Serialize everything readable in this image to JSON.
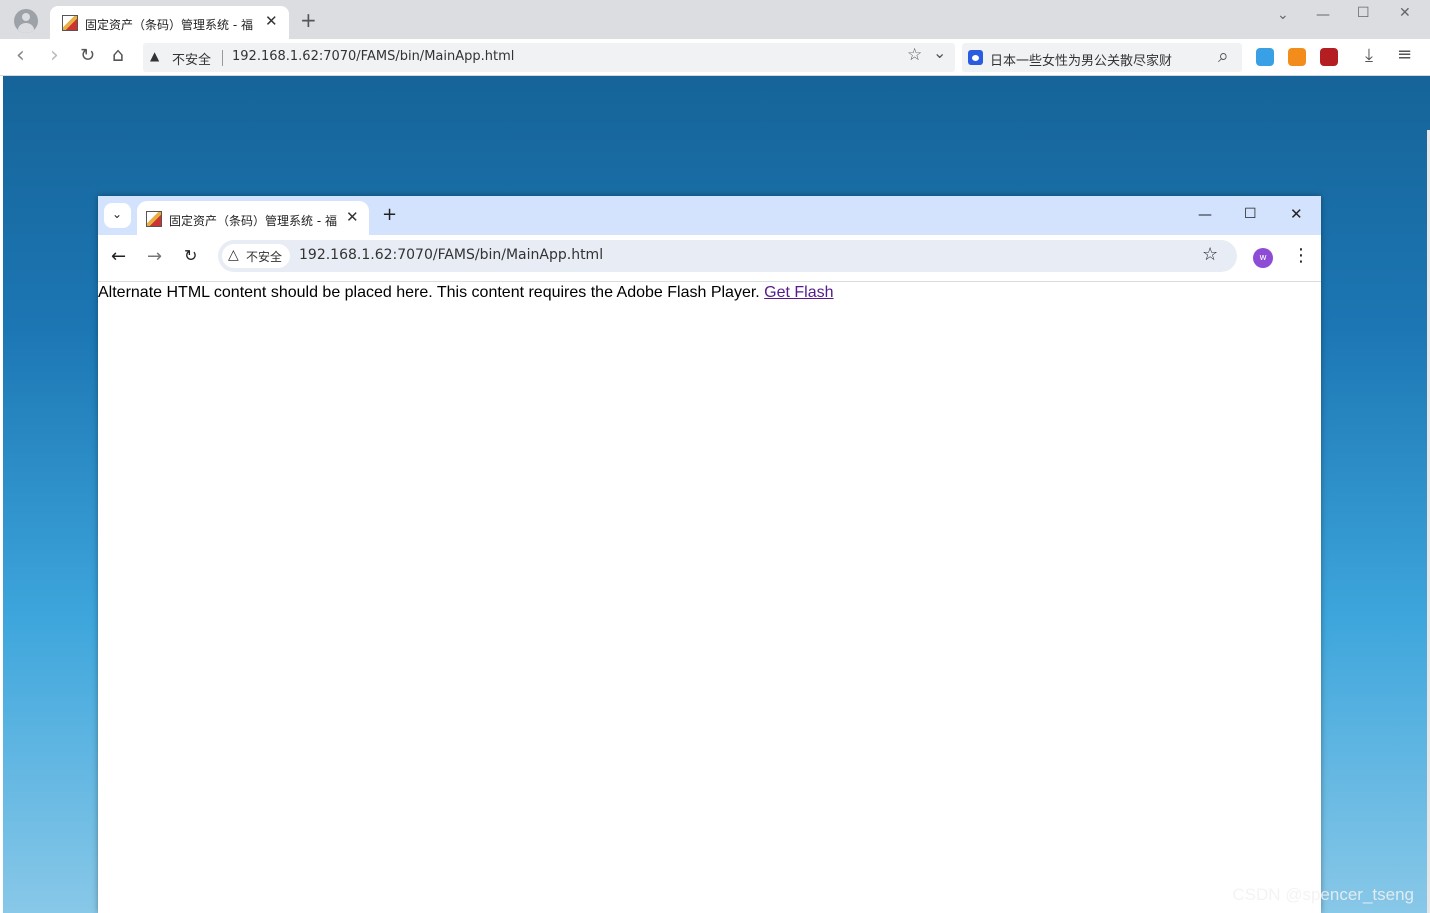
{
  "outer_browser": {
    "tab_title": "固定资产（条码）管理系统 - 福",
    "tab_close": "✕",
    "new_tab": "+",
    "window_controls": {
      "dropdown": "⌄",
      "minimize": "—",
      "maximize": "☐",
      "close": "✕"
    },
    "nav": {
      "back": "‹",
      "forward": "›",
      "reload": "↻",
      "home": "⌂"
    },
    "security_icon": "▲",
    "security_label": "不安全",
    "url": "192.168.1.62:7070/FAMS/bin/MainApp.html",
    "bookmark_star": "☆",
    "dropdown": "⌄",
    "search_text": "日本一些女性为男公关散尽家财",
    "search_icon": "⌕",
    "download_icon": "⤓",
    "menu_icon": "≡",
    "extension_colors": [
      "#3aa0e6",
      "#f28c1b",
      "#b41e22"
    ]
  },
  "inner_browser": {
    "tab_search": "⌄",
    "tab_title": "固定资产（条码）管理系统 - 福",
    "tab_close": "✕",
    "new_tab": "+",
    "window_controls": {
      "minimize": "—",
      "maximize": "☐",
      "close": "✕"
    },
    "nav": {
      "back": "←",
      "forward": "→",
      "reload": "↻"
    },
    "security_icon": "△",
    "security_label": "不安全",
    "url": "192.168.1.62:7070/FAMS/bin/MainApp.html",
    "bookmark_star": "☆",
    "profile_initial": "w",
    "menu_icon": "⋮"
  },
  "page": {
    "message": "Alternate HTML content should be placed here. This content requires the Adobe Flash Player. ",
    "link_text": "Get Flash"
  },
  "watermark": "CSDN @spencer_tseng"
}
